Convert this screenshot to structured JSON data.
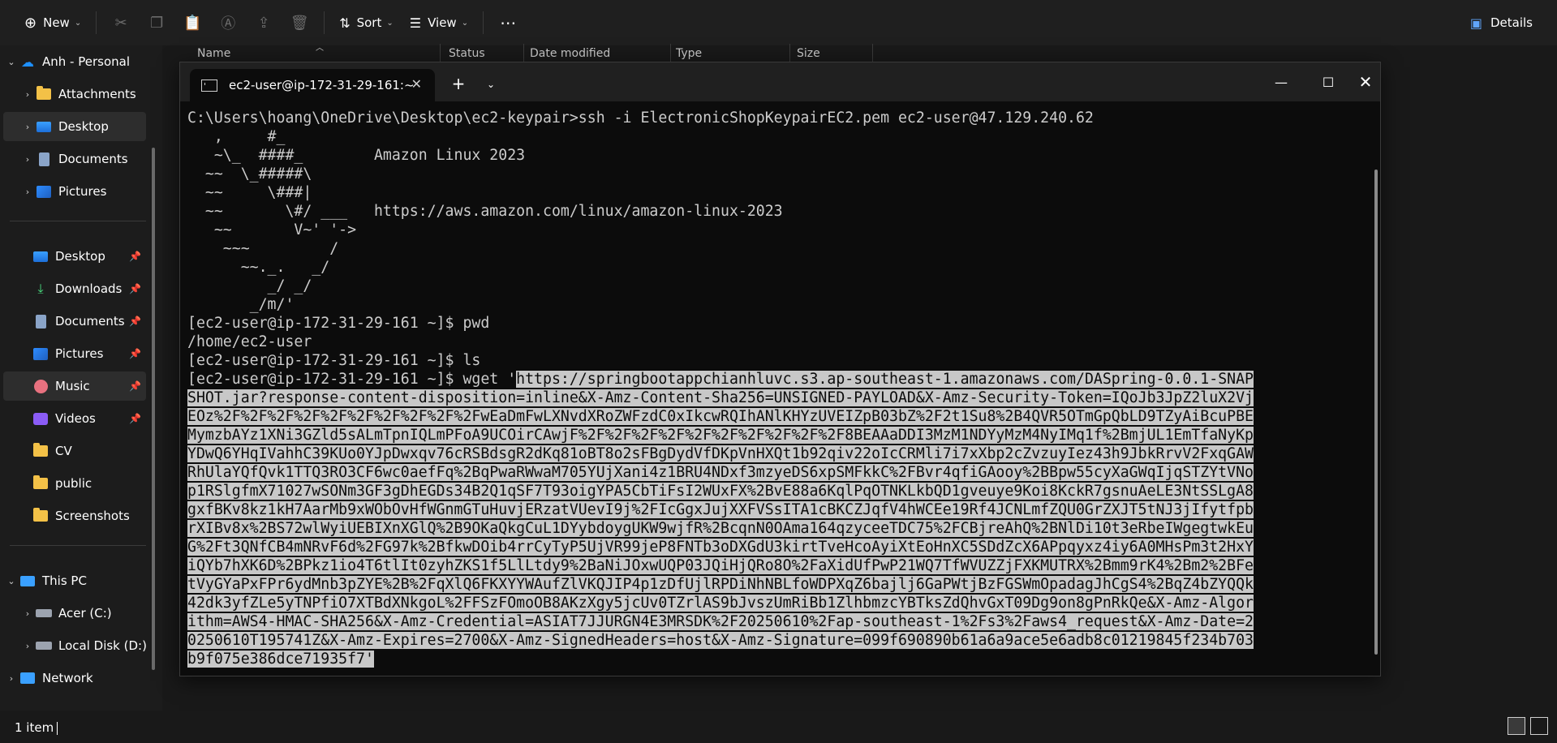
{
  "toolbar": {
    "new_label": "New",
    "sort_label": "Sort",
    "view_label": "View",
    "details_label": "Details"
  },
  "columns": [
    "Name",
    "Status",
    "Date modified",
    "Type",
    "Size"
  ],
  "sidebar": {
    "items": [
      {
        "label": "Anh - Personal",
        "icon": "cloud-icon"
      },
      {
        "label": "Attachments",
        "icon": "folder-icon"
      },
      {
        "label": "Desktop",
        "icon": "desktop-icon"
      },
      {
        "label": "Documents",
        "icon": "documents-icon"
      },
      {
        "label": "Pictures",
        "icon": "pictures-icon"
      },
      {
        "label": "Desktop",
        "icon": "desktop-icon"
      },
      {
        "label": "Downloads",
        "icon": "downloads-icon"
      },
      {
        "label": "Documents",
        "icon": "documents-icon"
      },
      {
        "label": "Pictures",
        "icon": "pictures-icon"
      },
      {
        "label": "Music",
        "icon": "music-icon"
      },
      {
        "label": "Videos",
        "icon": "videos-icon"
      },
      {
        "label": "CV",
        "icon": "folder-icon"
      },
      {
        "label": "public",
        "icon": "folder-icon"
      },
      {
        "label": "Screenshots",
        "icon": "folder-icon"
      },
      {
        "label": "This PC",
        "icon": "pc-icon"
      },
      {
        "label": "Acer (C:)",
        "icon": "drive-icon"
      },
      {
        "label": "Local Disk (D:)",
        "icon": "drive-icon"
      },
      {
        "label": "Network",
        "icon": "network-icon"
      }
    ]
  },
  "status": {
    "item_count": "1 item"
  },
  "terminal": {
    "tab_title": "ec2-user@ip-172-31-29-161:~",
    "lines": [
      "C:\\Users\\hoang\\OneDrive\\Desktop\\ec2-keypair>ssh -i ElectronicShopKeypairEC2.pem ec2-user@47.129.240.62",
      "   ,     #_",
      "   ~\\_  ####_        Amazon Linux 2023",
      "  ~~  \\_#####\\",
      "  ~~     \\###|",
      "  ~~       \\#/ ___   https://aws.amazon.com/linux/amazon-linux-2023",
      "   ~~       V~' '->",
      "    ~~~         /",
      "      ~~._.   _/",
      "         _/ _/",
      "       _/m/'",
      "[ec2-user@ip-172-31-29-161 ~]$ pwd",
      "/home/ec2-user",
      "[ec2-user@ip-172-31-29-161 ~]$ ls"
    ],
    "wget_prefix": "[ec2-user@ip-172-31-29-161 ~]$ wget '",
    "wget_url_first": "https://springbootappchianhluvc.s3.ap-southeast-1.amazonaws.com/DASpring-0.0.1-SNAP",
    "wget_url_lines": [
      "SHOT.jar?response-content-disposition=inline&X-Amz-Content-Sha256=UNSIGNED-PAYLOAD&X-Amz-Security-Token=IQoJb3JpZ2luX2Vj",
      "EOz%2F%2F%2F%2F%2F%2F%2F%2F%2F%2FwEaDmFwLXNvdXRoZWFzdC0xIkcwRQIhANlKHYzUVEIZpB03bZ%2F2t1Su8%2B4QVR5OTmGpQbLD9TZyAiBcuPBE",
      "MymzbAYz1XNi3GZld5sALmTpnIQLmPFoA9UCOirCAwjF%2F%2F%2F%2F%2F%2F%2F%2F%2F%2F8BEAAaDDI3MzM1NDYyMzM4NyIMq1f%2BmjUL1EmTfaNyKp",
      "YDwQ6YHqIVahhC39KUo0YJpDwxqv76cRSBdsgR2dKq81oBT8o2sFBgDydVfDKpVnHXQt1b92qiv22oIcCRMli7i7xXbp2cZvzuyIez43h9JbkRrvV2FxqGAW",
      "RhUlaYQfQvk1TTQ3RO3CF6wc0aefFq%2BqPwaRWwaM705YUjXani4z1BRU4NDxf3mzyeDS6xpSMFkkC%2FBvr4qfiGAooy%2BBpw55cyXaGWqIjqSTZYtVNo",
      "p1RSlgfmX71027wSONm3GF3gDhEGDs34B2Q1qSF7T93oigYPA5CbTiFsI2WUxFX%2BvE88a6KqlPqOTNKLkbQD1gveuye9Koi8KckR7gsnuAeLE3NtSSLgA8",
      "gxfBKv8kz1kH7AarMb9xWObOvHfWGnmGTuHuvjERzatVUevI9j%2FIcGgxJujXXFVSsITA1cBKCZJqfV4hWCEe19Rf4JCNLmfZQU0GrZXJT5tNJ3jIfytfpb",
      "rXIBv8x%2BS72wlWyiUEBIXnXGlQ%2B9OKaQkgCuL1DYybdoygUKW9wjfR%2BcqnN0OAma164qzyceeTDC75%2FCBjreAhQ%2BNlDi10t3eRbeIWgegtwkEu",
      "G%2Ft3QNfCB4mNRvF6d%2FG97k%2BfkwDOib4rrCyTyP5UjVR99jeP8FNTb3oDXGdU3kirtTveHcoAyiXtEoHnXC5SDdZcX6APpqyxz4iy6A0MHsPm3t2HxY",
      "iQYb7hXK6D%2BPkz1io4T6tlIt0zyhZKS1f5LlLtdy9%2BaNiJOxwUQP03JQiHjQRo8O%2FaXidUfPwP21WQ7TfWVUZZjFXKMUTRX%2Bmm9rK4%2Bm2%2BFe",
      "tVyGYaPxFPr6ydMnb3pZYE%2B%2FqXlQ6FKXYYWAufZlVKQJIP4p1zDfUjlRPDiNhNBLfoWDPXqZ6bajlj6GaPWtjBzFGSWmOpadagJhCgS4%2BqZ4bZYQQk",
      "42dk3yfZLe5yTNPfiO7XTBdXNkgoL%2FFSzFOmoOB8AKzXgy5jcUv0TZrlAS9bJvszUmRiBb1ZlhbmzcYBTksZdQhvGxT09Dg9on8gPnRkQe&X-Amz-Algor",
      "ithm=AWS4-HMAC-SHA256&X-Amz-Credential=ASIAT7JJURGN4E3MRSDK%2F20250610%2Fap-southeast-1%2Fs3%2Faws4_request&X-Amz-Date=2",
      "0250610T195741Z&X-Amz-Expires=2700&X-Amz-SignedHeaders=host&X-Amz-Signature=099f690890b61a6a9ace5e6adb8c01219845f234b703"
    ],
    "wget_url_last": "b9f075e386dce71935f7'"
  }
}
